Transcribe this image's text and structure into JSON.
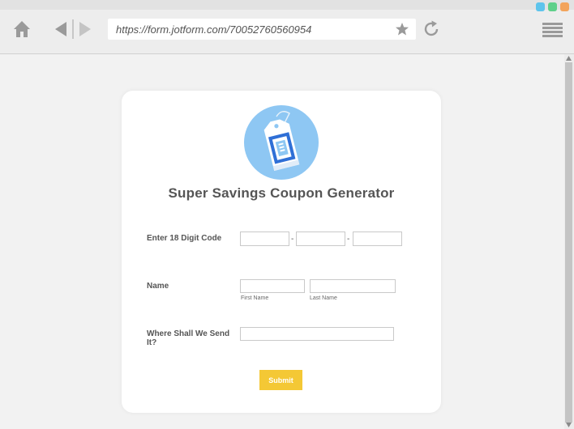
{
  "browser": {
    "url": "https://form.jotform.com/70052760560954",
    "icons": {
      "home": "home-icon",
      "back": "back-arrow-icon",
      "forward": "forward-arrow-icon",
      "bookmark": "star-icon",
      "reload": "reload-icon",
      "menu": "hamburger-menu-icon"
    },
    "window_dots": [
      "#5ec4ec",
      "#5fd08a",
      "#f3a45b"
    ]
  },
  "form": {
    "title": "Super Savings Coupon Generator",
    "logo_icon": "coupon-tag-icon",
    "fields": {
      "code": {
        "label": "Enter 18 Digit Code",
        "separator": "-",
        "values": [
          "",
          "",
          ""
        ]
      },
      "name": {
        "label": "Name",
        "first_sublabel": "First Name",
        "last_sublabel": "Last Name",
        "first_value": "",
        "last_value": ""
      },
      "send": {
        "label": "Where Shall We Send It?",
        "value": ""
      }
    },
    "submit_label": "Submit",
    "colors": {
      "submit": "#f4c835",
      "logo_bg": "#8ec7f3",
      "logo_accent": "#2f6fd6"
    }
  }
}
